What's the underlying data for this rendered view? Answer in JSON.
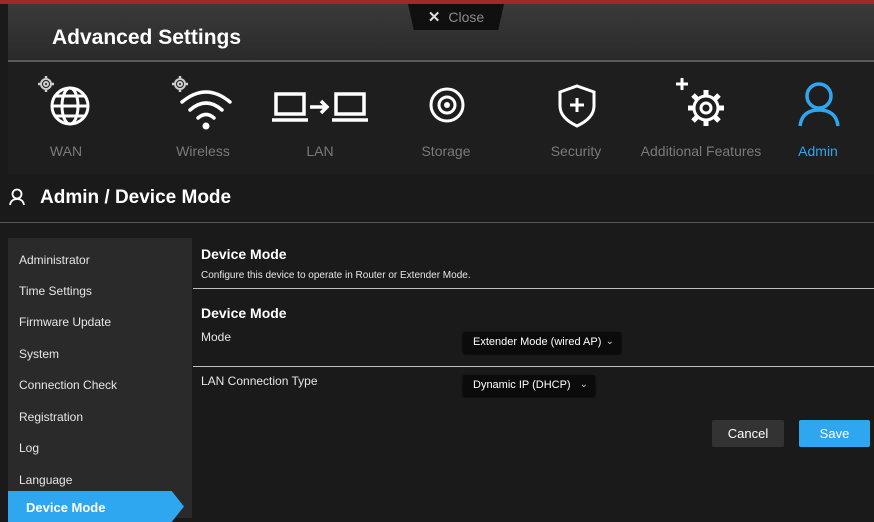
{
  "header": {
    "title": "Advanced Settings",
    "close_label": "Close"
  },
  "nav": {
    "items": [
      {
        "label": "WAN",
        "icon": "globe-icon"
      },
      {
        "label": "Wireless",
        "icon": "wifi-icon"
      },
      {
        "label": "LAN",
        "icon": "lan-icon"
      },
      {
        "label": "Storage",
        "icon": "storage-icon"
      },
      {
        "label": "Security",
        "icon": "shield-icon"
      },
      {
        "label": "Additional Features",
        "icon": "gears-icon"
      },
      {
        "label": "Admin",
        "icon": "user-icon",
        "active": true
      }
    ]
  },
  "page": {
    "title": "Admin / Device Mode"
  },
  "sidebar": {
    "items": [
      {
        "label": "Administrator"
      },
      {
        "label": "Time Settings"
      },
      {
        "label": "Firmware Update"
      },
      {
        "label": "System"
      },
      {
        "label": "Connection Check"
      },
      {
        "label": "Registration"
      },
      {
        "label": "Log"
      },
      {
        "label": "Language"
      },
      {
        "label": "Device Mode",
        "active": true
      }
    ]
  },
  "main": {
    "section_title": "Device Mode",
    "description": "Configure this device to operate in Router or Extender Mode.",
    "subsection_title": "Device Mode",
    "mode_label": "Mode",
    "mode_value": "Extender Mode (wired AP)",
    "lan_type_label": "LAN Connection Type",
    "lan_type_value": "Dynamic IP (DHCP)",
    "cancel_label": "Cancel",
    "save_label": "Save"
  },
  "colors": {
    "accent": "#2ea6f0",
    "header_strip": "#9b2b2b"
  }
}
